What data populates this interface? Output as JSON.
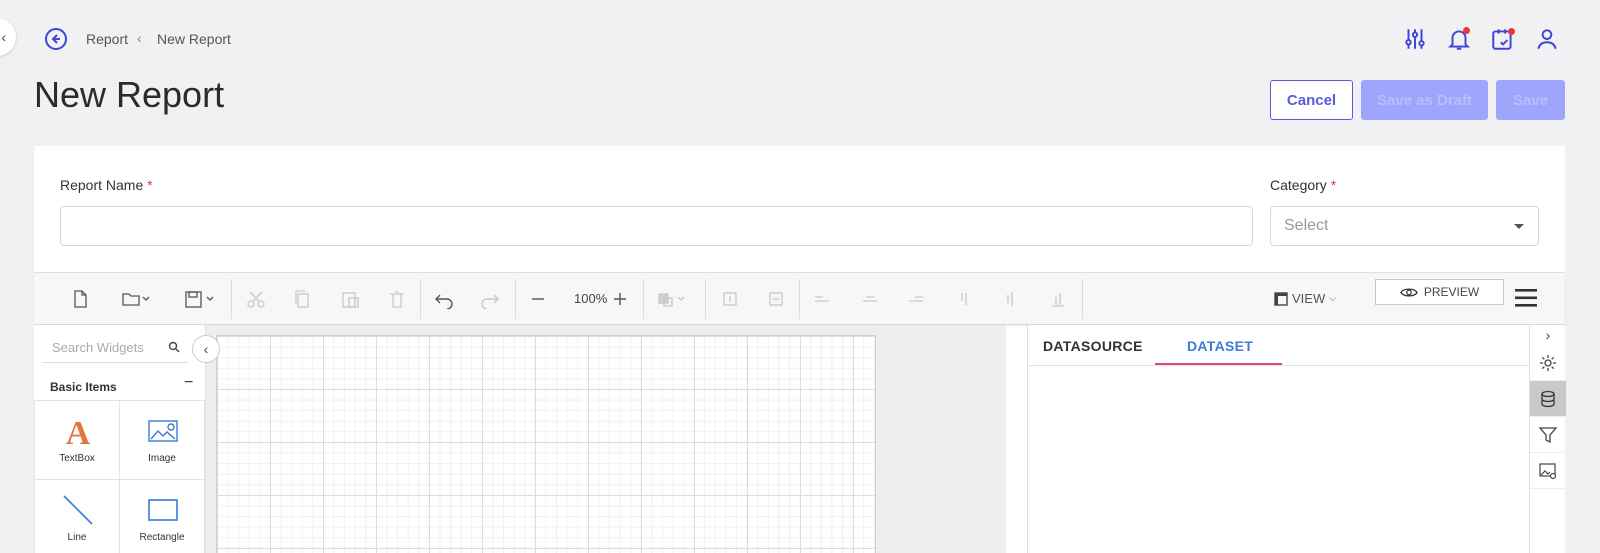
{
  "breadcrumb": {
    "parent": "Report",
    "current": "New Report"
  },
  "page": {
    "title": "New Report"
  },
  "actions": {
    "cancel": "Cancel",
    "save_draft": "Save as Draft",
    "save": "Save"
  },
  "form": {
    "report_name_label": "Report Name",
    "report_name_value": "",
    "required_mark": "*",
    "category_label": "Category",
    "category_placeholder": "Select"
  },
  "toolbar": {
    "zoom": "100%",
    "view_label": "VIEW",
    "preview_label": "PREVIEW"
  },
  "widgets": {
    "search_placeholder": "Search Widgets",
    "section_title": "Basic Items",
    "collapse_symbol": "−",
    "items": [
      {
        "label": "TextBox",
        "icon": "textbox-icon"
      },
      {
        "label": "Image",
        "icon": "image-icon"
      },
      {
        "label": "Line",
        "icon": "line-icon"
      },
      {
        "label": "Rectangle",
        "icon": "rectangle-icon"
      }
    ]
  },
  "properties": {
    "tabs": [
      "DATASOURCE",
      "DATASET"
    ],
    "active_tab": "DATASET"
  },
  "colors": {
    "accent": "#5b5bdb",
    "disabled_button": "#9fa5fa",
    "tab_active": "#3e7bd6",
    "tab_underline": "#e0457b",
    "required": "#e53935"
  }
}
